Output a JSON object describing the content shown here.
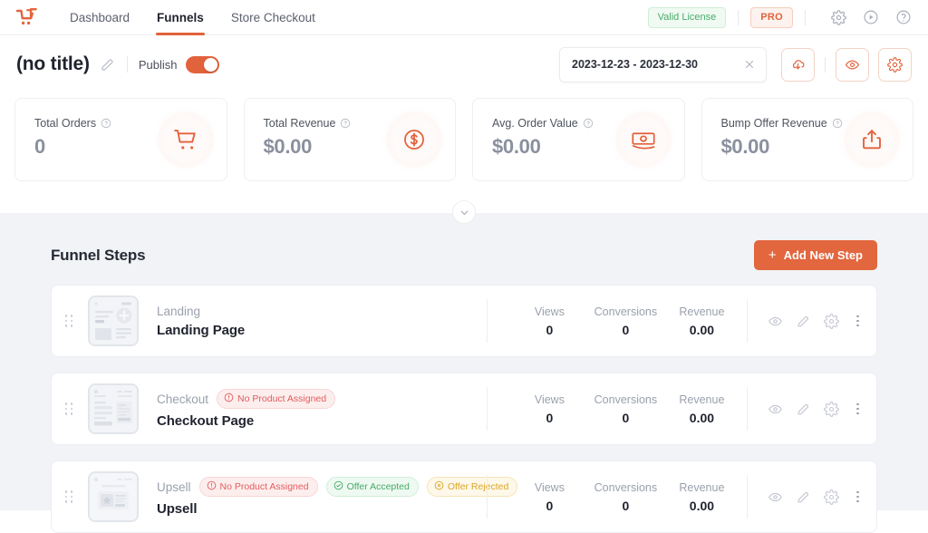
{
  "topnav": {
    "logo_icon": "cartflows-logo-icon",
    "items": [
      {
        "label": "Dashboard",
        "active": false
      },
      {
        "label": "Funnels",
        "active": true
      },
      {
        "label": "Store Checkout",
        "active": false
      }
    ],
    "license_badge": "Valid License",
    "pro_badge": "PRO",
    "icons": [
      {
        "name": "gear-icon"
      },
      {
        "name": "play-circle-icon"
      },
      {
        "name": "help-circle-icon"
      }
    ]
  },
  "titlebar": {
    "funnel_title": "(no title)",
    "edit_icon": "edit-pencil-icon",
    "publish_label": "Publish",
    "publish_on": true,
    "date_range": "2023-12-23 - 2023-12-30",
    "clear_icon": "close-x-icon",
    "actions": [
      {
        "name": "import-export-button",
        "icon": "cloud-download-icon"
      },
      {
        "name": "preview-button",
        "icon": "eye-icon"
      },
      {
        "name": "settings-button",
        "icon": "gear-icon"
      }
    ]
  },
  "stats": [
    {
      "label": "Total Orders",
      "value": "0",
      "icon": "shopping-cart-icon"
    },
    {
      "label": "Total Revenue",
      "value": "$0.00",
      "icon": "dollar-circle-icon"
    },
    {
      "label": "Avg. Order Value",
      "value": "$0.00",
      "icon": "banknote-icon"
    },
    {
      "label": "Bump Offer Revenue",
      "value": "$0.00",
      "icon": "share-upload-icon"
    }
  ],
  "collapse": {
    "icon": "chevron-down-icon"
  },
  "funnel_steps": {
    "title": "Funnel Steps",
    "add_button": "Add New Step",
    "add_button_plus": "+",
    "metric_labels": {
      "views": "Views",
      "conversions": "Conversions",
      "revenue": "Revenue"
    },
    "rows": [
      {
        "kind": "Landing",
        "name": "Landing Page",
        "badges": [],
        "views": "0",
        "conversions": "0",
        "revenue": "0.00",
        "thumb": "landing-thumbnail"
      },
      {
        "kind": "Checkout",
        "name": "Checkout Page",
        "badges": [
          {
            "text": "No Product Assigned",
            "tone": "red",
            "icon": "alert-circle-icon"
          }
        ],
        "views": "0",
        "conversions": "0",
        "revenue": "0.00",
        "thumb": "checkout-thumbnail"
      },
      {
        "kind": "Upsell",
        "name": "Upsell",
        "badges": [
          {
            "text": "No Product Assigned",
            "tone": "red",
            "icon": "alert-circle-icon"
          },
          {
            "text": "Offer Accepted",
            "tone": "green",
            "icon": "check-circle-icon"
          },
          {
            "text": "Offer Rejected",
            "tone": "amber",
            "icon": "x-circle-icon"
          }
        ],
        "views": "0",
        "conversions": "0",
        "revenue": "0.00",
        "thumb": "upsell-thumbnail"
      }
    ],
    "row_actions": [
      {
        "name": "preview-step-icon"
      },
      {
        "name": "edit-step-icon"
      },
      {
        "name": "step-settings-icon"
      },
      {
        "name": "more-options-icon"
      }
    ]
  },
  "colors": {
    "accent": "#e2663e",
    "page_bg": "#f2f3f6",
    "success": "#47a96a",
    "danger": "#e35c5c",
    "warning": "#dda628"
  }
}
